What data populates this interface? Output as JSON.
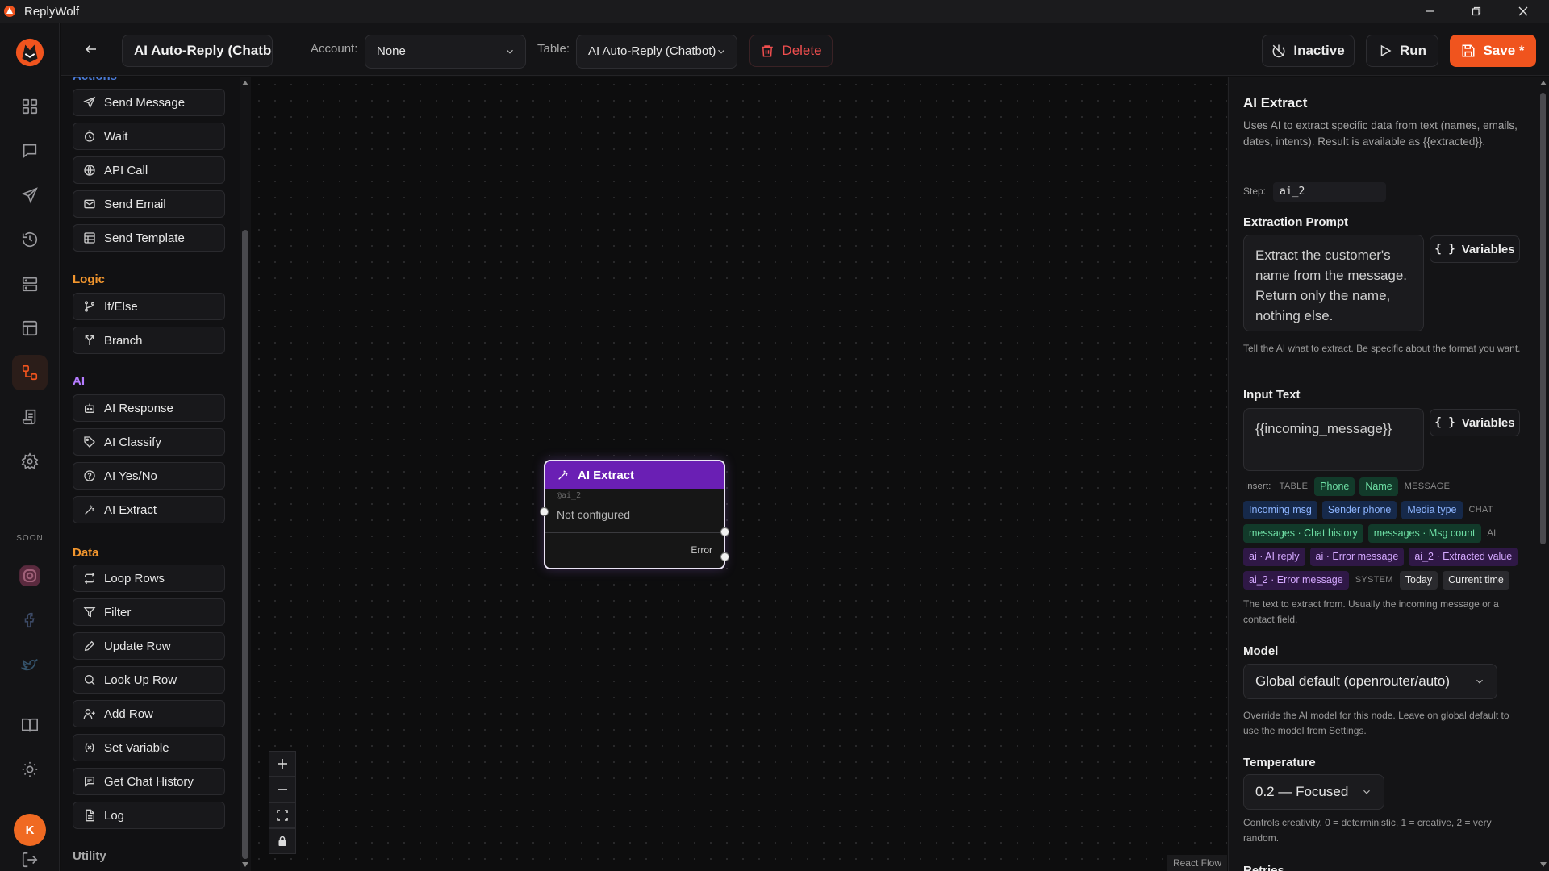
{
  "app": {
    "title": "ReplyWolf",
    "soon_label": "SOON",
    "user_initial": "K"
  },
  "toolbar": {
    "flow_name": "AI Auto-Reply (Chatbot)",
    "account_label": "Account:",
    "account_value": "None",
    "table_label": "Table:",
    "table_value": "AI Auto-Reply (Chatbot)",
    "delete_label": "Delete",
    "inactive_label": "Inactive",
    "run_label": "Run",
    "save_label": "Save *"
  },
  "palette": {
    "partial_header": "Actions",
    "sections": [
      {
        "title": "Logic",
        "color": "#f2962e"
      },
      {
        "title": "AI",
        "color": "#b57cff"
      },
      {
        "title": "Data",
        "color": "#f2962e"
      },
      {
        "title": "Utility",
        "color": "#a8a8a8"
      }
    ],
    "items": [
      {
        "label": "Send Message",
        "icon": "send-icon"
      },
      {
        "label": "Wait",
        "icon": "timer-icon"
      },
      {
        "label": "API Call",
        "icon": "globe-icon"
      },
      {
        "label": "Send Email",
        "icon": "mail-icon"
      },
      {
        "label": "Send Template",
        "icon": "template-icon"
      },
      {
        "label": "If/Else",
        "icon": "git-branch-icon"
      },
      {
        "label": "Branch",
        "icon": "split-icon"
      },
      {
        "label": "AI Response",
        "icon": "bot-icon"
      },
      {
        "label": "AI Classify",
        "icon": "tag-icon"
      },
      {
        "label": "AI Yes/No",
        "icon": "help-circle-icon"
      },
      {
        "label": "AI Extract",
        "icon": "wand-icon"
      },
      {
        "label": "Loop Rows",
        "icon": "repeat-icon"
      },
      {
        "label": "Filter",
        "icon": "filter-icon"
      },
      {
        "label": "Update Row",
        "icon": "pencil-icon"
      },
      {
        "label": "Look Up Row",
        "icon": "search-icon"
      },
      {
        "label": "Add Row",
        "icon": "user-plus-icon"
      },
      {
        "label": "Set Variable",
        "icon": "variable-icon"
      },
      {
        "label": "Get Chat History",
        "icon": "chat-history-icon"
      },
      {
        "label": "Log",
        "icon": "file-text-icon"
      }
    ]
  },
  "node": {
    "title": "AI Extract",
    "id": "@ai_2",
    "status": "Not configured",
    "error_label": "Error"
  },
  "canvas": {
    "attribution": "React Flow"
  },
  "panel": {
    "title": "AI Extract",
    "description": "Uses AI to extract specific data from text (names, emails, dates, intents). Result is available as {{extracted}}.",
    "step_label": "Step:",
    "step_value": "ai_2",
    "extraction_prompt_label": "Extraction Prompt",
    "extraction_prompt_value": "Extract the customer's name from the message. Return only the name, nothing else.",
    "extraction_prompt_help": "Tell the AI what to extract. Be specific about the format you want.",
    "variables_label": "Variables",
    "input_text_label": "Input Text",
    "input_text_value": "{{incoming_message}}",
    "insert_label": "Insert:",
    "chip_groups": [
      {
        "group": "TABLE",
        "chips": [
          {
            "label": "Phone",
            "style": "green"
          },
          {
            "label": "Name",
            "style": "green"
          }
        ]
      },
      {
        "group": "MESSAGE",
        "chips": [
          {
            "label": "Incoming msg",
            "style": "blue"
          },
          {
            "label": "Sender phone",
            "style": "blue"
          },
          {
            "label": "Media type",
            "style": "blue"
          }
        ]
      },
      {
        "group": "CHAT",
        "chips": [
          {
            "label": "messages · Chat history",
            "style": "green"
          },
          {
            "label": "messages · Msg count",
            "style": "green"
          }
        ]
      },
      {
        "group": "AI",
        "chips": [
          {
            "label": "ai · AI reply",
            "style": "purple"
          },
          {
            "label": "ai · Error message",
            "style": "purple"
          },
          {
            "label": "ai_2 · Extracted value",
            "style": "purple"
          },
          {
            "label": "ai_2 · Error message",
            "style": "purple"
          }
        ]
      },
      {
        "group": "SYSTEM",
        "chips": [
          {
            "label": "Today",
            "style": "gray"
          },
          {
            "label": "Current time",
            "style": "gray"
          }
        ]
      }
    ],
    "input_text_help": "The text to extract from. Usually the incoming message or a contact field.",
    "model_label": "Model",
    "model_value": "Global default (openrouter/auto)",
    "model_help": "Override the AI model for this node. Leave on global default to use the model from Settings.",
    "temperature_label": "Temperature",
    "temperature_value": "0.2 — Focused",
    "temperature_help": "Controls creativity. 0 = deterministic, 1 = creative, 2 = very random.",
    "retries_label": "Retries"
  },
  "colors": {
    "accent": "#f0541e",
    "node_header": "#6a1fb4",
    "danger": "#ef4e4e"
  }
}
